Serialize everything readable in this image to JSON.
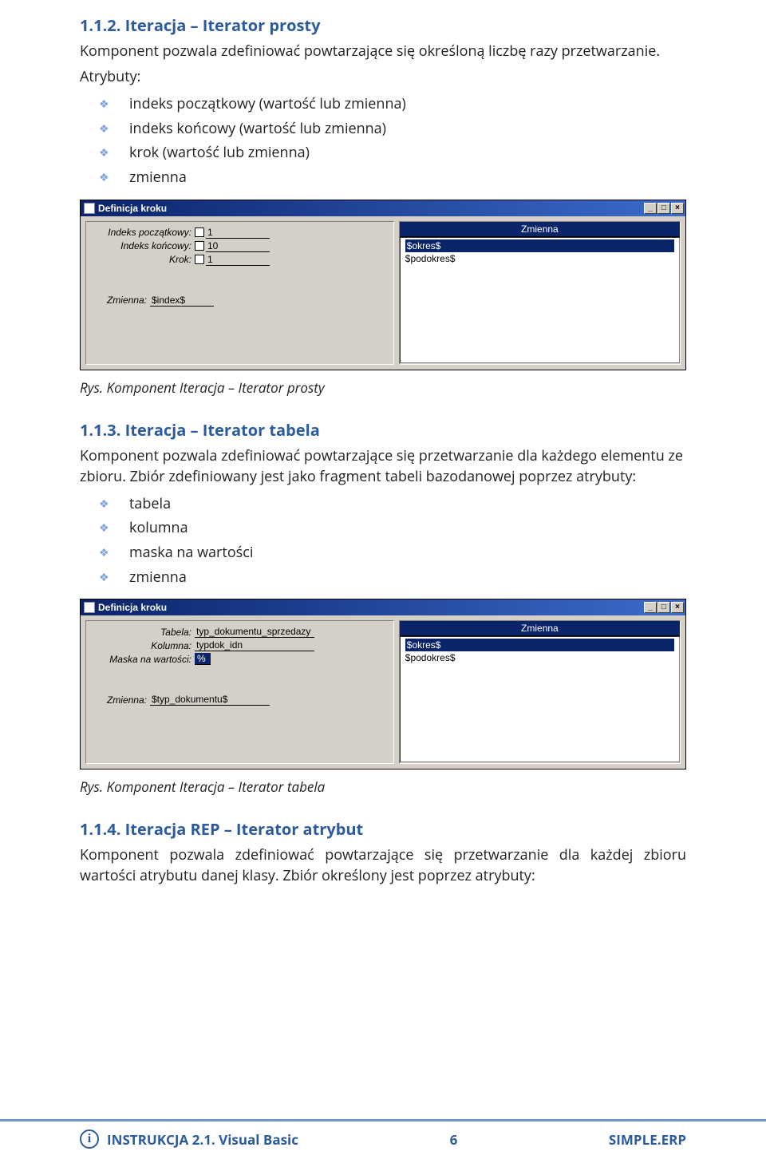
{
  "section112": {
    "heading": "1.1.2.  Iteracja – Iterator prosty",
    "intro1": "Komponent pozwala zdefiniować powtarzające się określoną liczbę razy przetwarzanie.",
    "intro2": "Atrybuty:",
    "bullets": [
      "indeks początkowy (wartość lub zmienna)",
      "indeks końcowy (wartość lub zmienna)",
      "krok (wartość lub zmienna)",
      "zmienna"
    ],
    "caption": "Rys. Komponent Iteracja – Iterator prosty"
  },
  "win1": {
    "title": "Definicja kroku",
    "btn_min": "_",
    "btn_max": "□",
    "btn_close": "×",
    "lbl_start": "Indeks początkowy:",
    "val_start": "1",
    "lbl_end": "Indeks końcowy:",
    "val_end": "10",
    "lbl_step": "Krok:",
    "val_step": "1",
    "lbl_var": "Zmienna:",
    "val_var": "$index$",
    "right_header": "Zmienna",
    "vars": {
      "v1": "$okres$",
      "v2": "$podokres$"
    }
  },
  "section113": {
    "heading": "1.1.3.  Iteracja – Iterator tabela",
    "p1": "Komponent pozwala zdefiniować powtarzające się przetwarzanie dla każdego elementu ze zbioru. Zbiór zdefiniowany jest jako fragment tabeli bazodanowej poprzez atrybuty:",
    "bullets": [
      "tabela",
      "kolumna",
      "maska na wartości",
      "zmienna"
    ],
    "caption": "Rys. Komponent Iteracja – Iterator tabela"
  },
  "win2": {
    "title": "Definicja kroku",
    "btn_min": "_",
    "btn_max": "□",
    "btn_close": "×",
    "lbl_table": "Tabela:",
    "val_table": "typ_dokumentu_sprzedazy",
    "lbl_col": "Kolumna:",
    "val_col": "typdok_idn",
    "lbl_mask": "Maska na wartości:",
    "val_mask": "%",
    "lbl_var": "Zmienna:",
    "val_var": "$typ_dokumentu$",
    "right_header": "Zmienna",
    "vars": {
      "v1": "$okres$",
      "v2": "$podokres$"
    }
  },
  "section114": {
    "heading": "1.1.4.  Iteracja REP – Iterator atrybut",
    "p1": "Komponent pozwala zdefiniować powtarzające się przetwarzanie dla każdej zbioru wartości atrybutu danej klasy. Zbiór określony jest poprzez atrybuty:"
  },
  "footer": {
    "left": "INSTRUKCJA 2.1. Visual Basic",
    "page": "6",
    "right": "SIMPLE.ERP"
  }
}
